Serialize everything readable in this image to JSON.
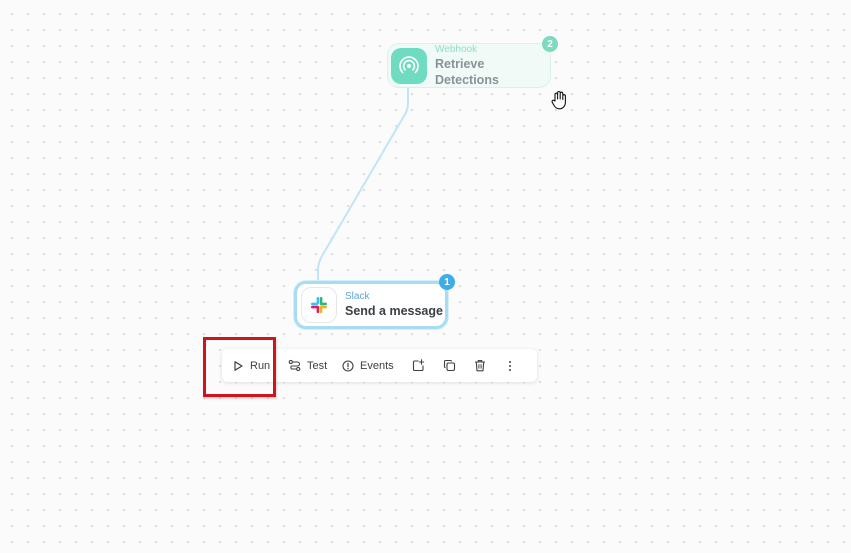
{
  "canvas": {
    "accent_color": "#3dade9",
    "annotation_color": "#d0141b"
  },
  "nodes": [
    {
      "id": "webhook",
      "type_label": "Webhook",
      "title": "Retrieve Detections",
      "badge": "2",
      "icon": "webhook-signal-icon",
      "accent_color": "#6fdcc1"
    },
    {
      "id": "slack",
      "type_label": "Slack",
      "title": "Send a message",
      "badge": "1",
      "icon": "slack-logo-icon",
      "accent_color": "#3dade9",
      "selected": true
    }
  ],
  "toolbar": {
    "run_label": "Run",
    "test_label": "Test",
    "events_label": "Events",
    "icons": [
      "play-icon",
      "test-flow-icon",
      "info-circle-icon",
      "share-export-icon",
      "copy-icon",
      "trash-icon",
      "more-vertical-icon"
    ]
  },
  "cursor": "grab-hand-icon"
}
